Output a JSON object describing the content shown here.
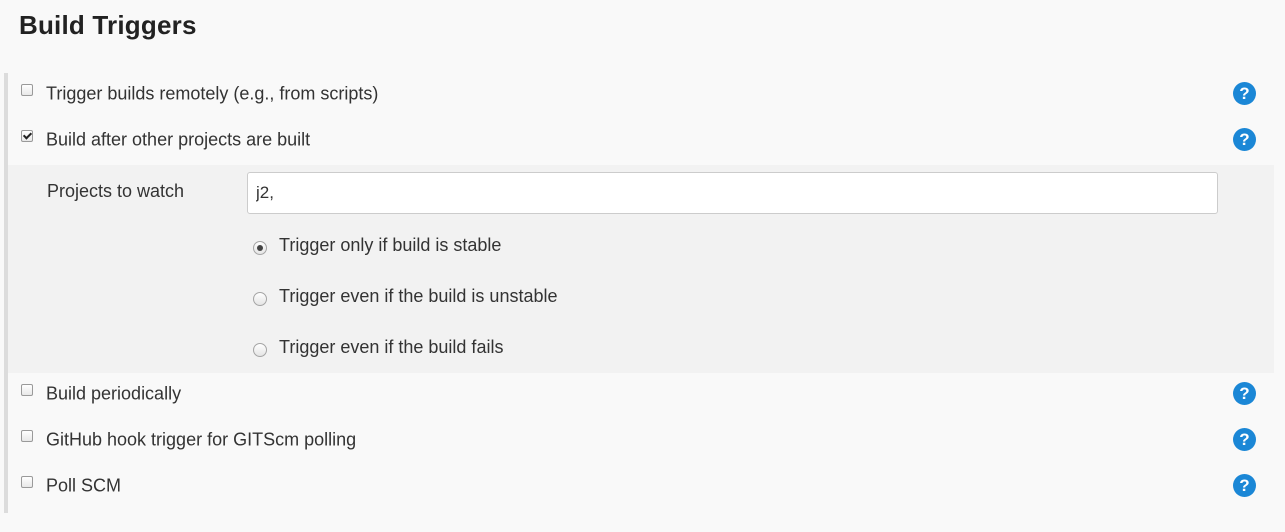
{
  "section": {
    "title": "Build Triggers"
  },
  "triggers": [
    {
      "label": "Trigger builds remotely (e.g., from scripts)",
      "checked": false
    },
    {
      "label": "Build after other projects are built",
      "checked": true
    },
    {
      "label": "Build periodically",
      "checked": false
    },
    {
      "label": "GitHub hook trigger for GITScm polling",
      "checked": false
    },
    {
      "label": "Poll SCM",
      "checked": false
    }
  ],
  "build_after": {
    "projects_label": "Projects to watch",
    "projects_value": "j2,",
    "options": [
      {
        "label": "Trigger only if build is stable",
        "selected": true
      },
      {
        "label": "Trigger even if the build is unstable",
        "selected": false
      },
      {
        "label": "Trigger even if the build fails",
        "selected": false
      }
    ]
  },
  "help_glyph": "?",
  "colors": {
    "help_icon": "#1b87d6",
    "panel_background": "#f2f2f2",
    "page_background": "#f9f9f9"
  },
  "icons": {
    "help": "help-icon"
  }
}
